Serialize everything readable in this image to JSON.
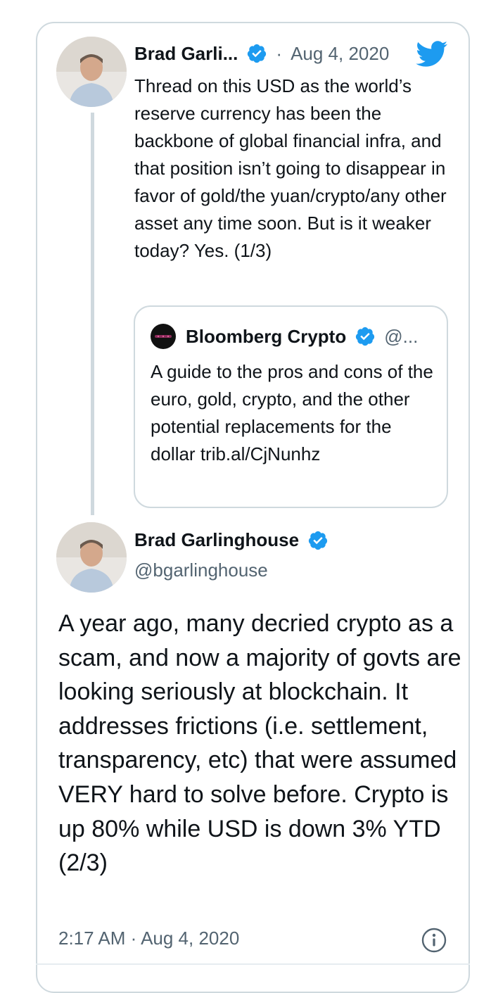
{
  "tweet1": {
    "author_name": "Brad Garli...",
    "date": "Aug 4, 2020",
    "separator": "·",
    "text": "Thread on this USD as the world’s reserve currency has been the backbone of global financial infra, and that position isn’t going to disappear in favor of gold/the yuan/crypto/any other asset any time soon. But is it weaker today? Yes. (1/3)"
  },
  "quote": {
    "author_name": "Bloomberg Crypto",
    "handle": "@...",
    "text": "A guide to the pros and cons of the euro, gold, crypto, and the other potential replacements for the dollar trib.al/CjNunhz"
  },
  "tweet2": {
    "author_name": "Brad Garlinghouse",
    "handle": "@bgarlinghouse",
    "text": "A year ago, many decried crypto as a scam, and now a majority of govts are looking seriously at blockchain. It addresses frictions (i.e. settlement, transparency, etc) that were assumed VERY hard to solve before. Crypto is up 80% while USD is down 3% YTD (2/3)",
    "timestamp": "2:17 AM · Aug 4, 2020"
  },
  "colors": {
    "verified": "#1d9bf0",
    "secondary_text": "#536471",
    "border": "#cfd9de"
  },
  "icons": {
    "verified": "verified-badge-icon",
    "brand": "twitter-bird-icon",
    "info": "info-icon"
  }
}
